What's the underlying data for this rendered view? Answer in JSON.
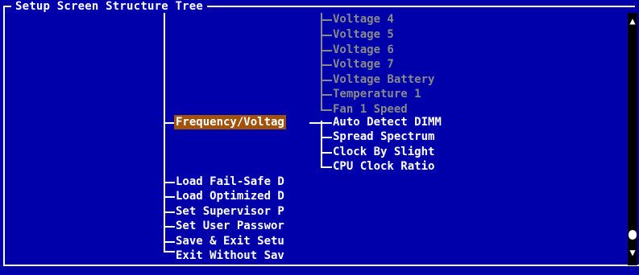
{
  "window": {
    "title": "Setup Screen Structure Tree"
  },
  "tree": {
    "upper_items": [
      {
        "label": "Voltage 4",
        "state": "dimmed"
      },
      {
        "label": "Voltage 5",
        "state": "dimmed"
      },
      {
        "label": "Voltage 6",
        "state": "dimmed"
      },
      {
        "label": "Voltage 7",
        "state": "dimmed"
      },
      {
        "label": "Voltage Battery",
        "state": "dimmed"
      },
      {
        "label": "Temperature 1",
        "state": "dimmed"
      },
      {
        "label": "Fan 1 Speed",
        "state": "dimmed"
      }
    ],
    "selected_item": {
      "label": "Frequency/Voltag",
      "state": "selected"
    },
    "selected_children": [
      {
        "label": "Auto Detect DIMM"
      },
      {
        "label": "Spread Spectrum"
      },
      {
        "label": "Clock By Slight"
      },
      {
        "label": "CPU Clock Ratio"
      }
    ],
    "main_items": [
      {
        "label": "Load Fail-Safe D"
      },
      {
        "label": "Load Optimized D"
      },
      {
        "label": "Set Supervisor P"
      },
      {
        "label": "Set User Passwor"
      },
      {
        "label": "Save & Exit Setu"
      },
      {
        "label": "Exit Without Sav"
      }
    ]
  },
  "scrollbar": {
    "up_icon": "arrow-up-icon",
    "down_icon": "arrow-down-icon",
    "position": 0.88
  },
  "colors": {
    "background": "#0000aa",
    "text": "#ffffff",
    "dimmed": "#8a8a8a",
    "selection": "#a0520a",
    "scrollbar_track": "#000000"
  }
}
